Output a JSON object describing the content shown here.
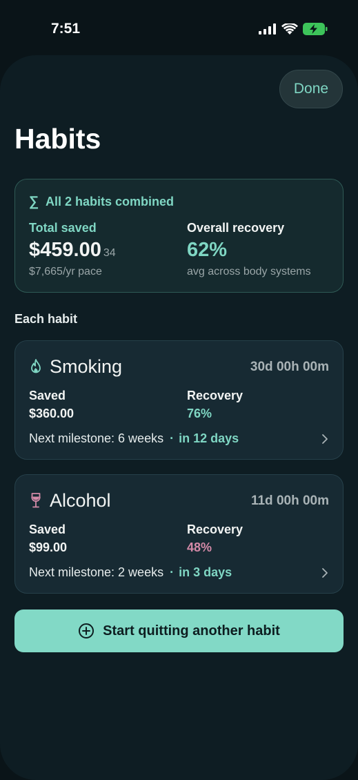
{
  "status_bar": {
    "time": "7:51"
  },
  "header": {
    "done_label": "Done",
    "title": "Habits"
  },
  "combined": {
    "heading": "All 2 habits combined",
    "total_saved_label": "Total saved",
    "total_saved_value": "$459.00",
    "total_saved_cents": "34",
    "pace_note": "$7,665/yr pace",
    "recovery_label": "Overall recovery",
    "recovery_value": "62%",
    "recovery_note": "avg across body systems"
  },
  "section_label": "Each habit",
  "habits": [
    {
      "name": "Smoking",
      "icon": "flame-icon",
      "timer": "30d 00h 00m",
      "saved_label": "Saved",
      "saved_value": "$360.00",
      "recovery_label": "Recovery",
      "recovery_value": "76%",
      "recovery_color": "#7fd6c3",
      "milestone_text": "Next milestone: 6 weeks",
      "milestone_sep": "·",
      "milestone_eta": "in 12 days"
    },
    {
      "name": "Alcohol",
      "icon": "wine-glass-icon",
      "timer": "11d 00h 00m",
      "saved_label": "Saved",
      "saved_value": "$99.00",
      "recovery_label": "Recovery",
      "recovery_value": "48%",
      "recovery_color": "#d48aa8",
      "milestone_text": "Next milestone: 2 weeks",
      "milestone_sep": "·",
      "milestone_eta": "in 3 days"
    }
  ],
  "cta_label": "Start quitting another habit",
  "colors": {
    "accent": "#7fd6c3",
    "background": "#0e1d23",
    "alcohol_accent": "#d48aa8"
  }
}
